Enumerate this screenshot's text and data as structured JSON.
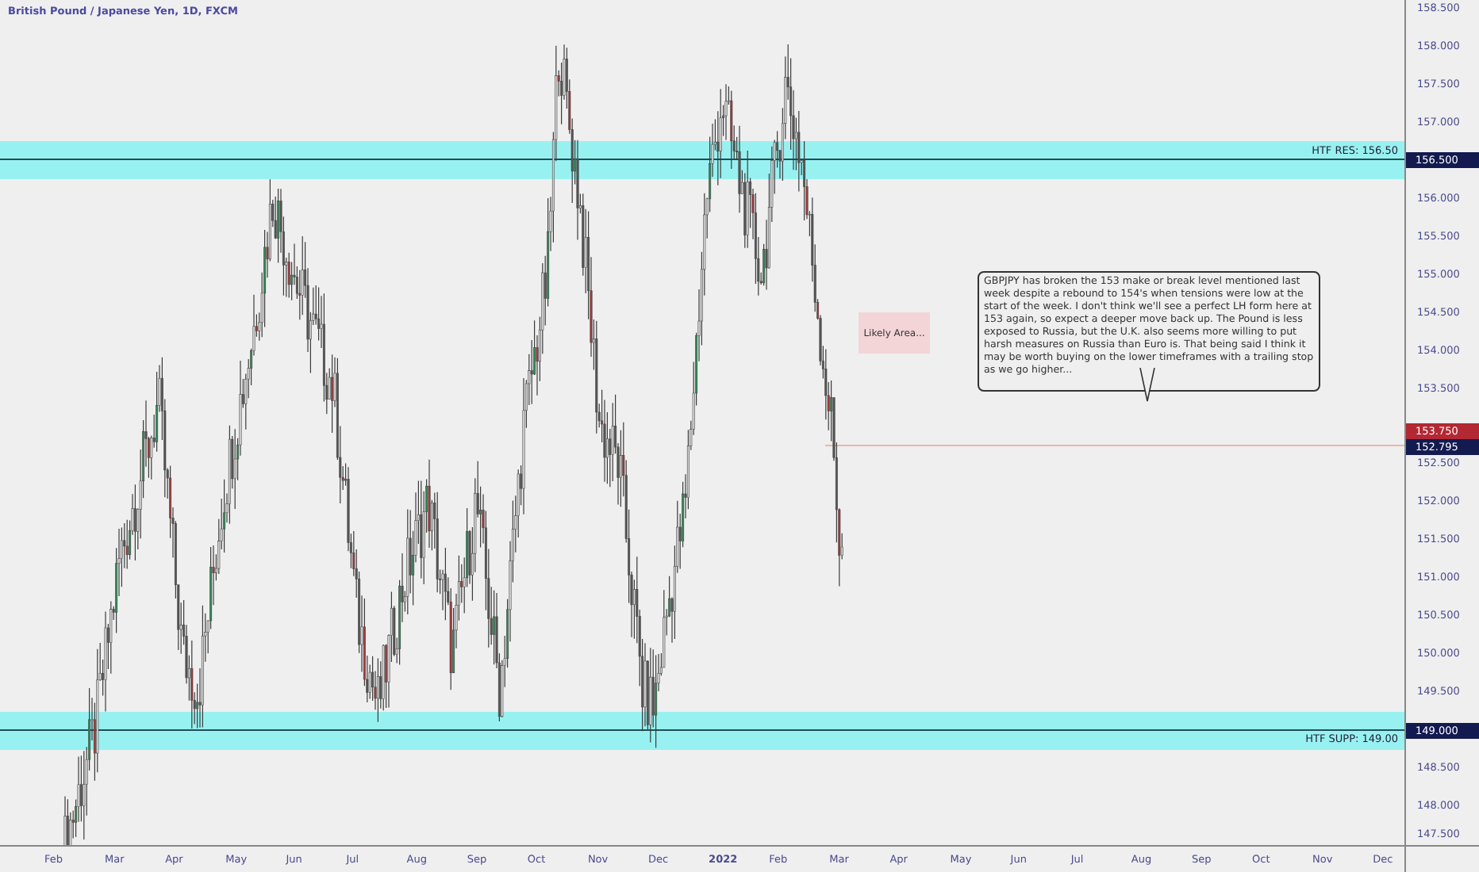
{
  "chart_title": "British Pound / Japanese Yen, 1D, FXCM",
  "price_axis": {
    "ticks": [
      "158.500",
      "158.000",
      "157.500",
      "157.000",
      "156.000",
      "155.500",
      "155.000",
      "154.500",
      "154.000",
      "153.500",
      "152.500",
      "152.000",
      "151.500",
      "151.000",
      "150.500",
      "150.000",
      "149.500",
      "148.500",
      "148.000",
      "147.500"
    ]
  },
  "price_badges": [
    {
      "text": "156.500",
      "color": "#131a4f"
    },
    {
      "text": "153.750",
      "color": "#b22833"
    },
    {
      "text": "152.795",
      "color": "#131a4f"
    },
    {
      "text": "149.000",
      "color": "#131a4f"
    }
  ],
  "zones": [
    {
      "kind": "resistance",
      "label": "HTF RES: 156.50"
    },
    {
      "kind": "support",
      "label": "HTF SUPP: 149.00"
    }
  ],
  "notes": [
    {
      "kind": "label",
      "text": "Likely Area..."
    },
    {
      "kind": "callout",
      "text": "GBPJPY has broken the 153 make or break level mentioned last week despite a rebound to 154's when tensions were low at the start of the week. I don't think we'll see a perfect LH form here at 153 again, so expect a deeper move back up. The Pound is less exposed to Russia, but the U.K. also seems more willing to put harsh measures on Russia than Euro is.  That being said I think it may be worth buying on the lower timeframes with a trailing stop as we go higher..."
    }
  ],
  "time_axis": [
    {
      "label": "Feb",
      "bold": false
    },
    {
      "label": "Mar",
      "bold": false
    },
    {
      "label": "Apr",
      "bold": false
    },
    {
      "label": "May",
      "bold": false
    },
    {
      "label": "Jun",
      "bold": false
    },
    {
      "label": "Jul",
      "bold": false
    },
    {
      "label": "Aug",
      "bold": false
    },
    {
      "label": "Sep",
      "bold": false
    },
    {
      "label": "Oct",
      "bold": false
    },
    {
      "label": "Nov",
      "bold": false
    },
    {
      "label": "Dec",
      "bold": false
    },
    {
      "label": "2022",
      "bold": true
    },
    {
      "label": "Feb",
      "bold": false
    },
    {
      "label": "Mar",
      "bold": false
    },
    {
      "label": "Apr",
      "bold": false
    },
    {
      "label": "May",
      "bold": false
    },
    {
      "label": "Jun",
      "bold": false
    },
    {
      "label": "Jul",
      "bold": false
    },
    {
      "label": "Aug",
      "bold": false
    },
    {
      "label": "Sep",
      "bold": false
    },
    {
      "label": "Oct",
      "bold": false
    },
    {
      "label": "Nov",
      "bold": false
    },
    {
      "label": "Dec",
      "bold": false
    }
  ]
}
